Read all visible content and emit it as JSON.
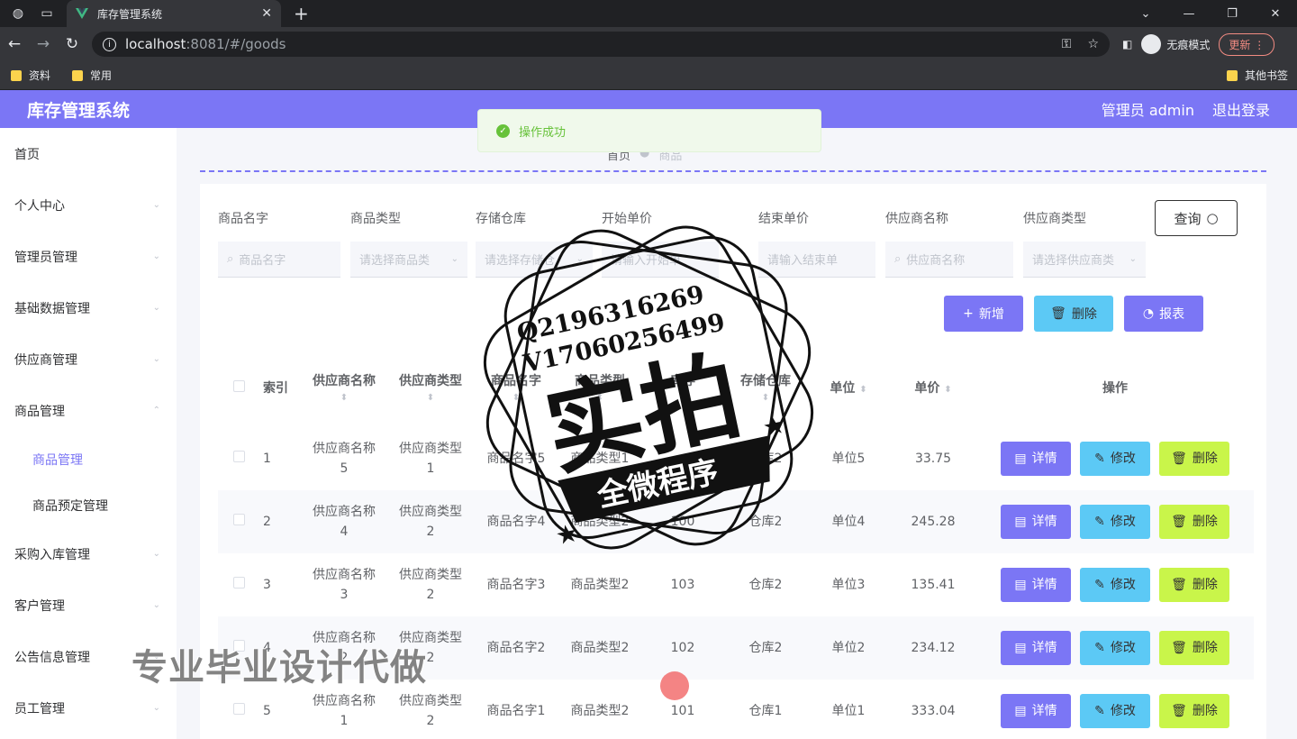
{
  "browser": {
    "tab_title": "库存管理系统",
    "url_host": "localhost",
    "url_path": ":8081/#/goods",
    "incognito_label": "无痕模式",
    "update_label": "更新",
    "bookmarks": [
      "资料",
      "常用"
    ],
    "other_bookmarks": "其他书签"
  },
  "header": {
    "title": "库存管理系统",
    "user_label": "管理员 admin",
    "logout_label": "退出登录"
  },
  "sidebar": {
    "items": [
      {
        "label": "首页"
      },
      {
        "label": "个人中心"
      },
      {
        "label": "管理员管理"
      },
      {
        "label": "基础数据管理"
      },
      {
        "label": "供应商管理"
      },
      {
        "label": "商品管理"
      }
    ],
    "sub_items": [
      {
        "label": "商品管理"
      },
      {
        "label": "商品预定管理"
      }
    ],
    "items_after": [
      {
        "label": "采购入库管理"
      },
      {
        "label": "客户管理"
      },
      {
        "label": "公告信息管理"
      },
      {
        "label": "员工管理"
      }
    ]
  },
  "breadcrumb": [
    "首页",
    "商品"
  ],
  "toast": "操作成功",
  "filters": {
    "labels": [
      "商品名字",
      "商品类型",
      "存储仓库",
      "开始单价",
      "结束单价",
      "供应商名称",
      "供应商类型"
    ],
    "placeholders": [
      "商品名字",
      "请选择商品类",
      "请选择存储仓",
      "请输入开始单",
      "请输入结束单",
      "供应商名称",
      "请选择供应商类"
    ],
    "query_label": "查询"
  },
  "actions": {
    "add": "新增",
    "delete": "删除",
    "report": "报表"
  },
  "table": {
    "headers": [
      "索引",
      "供应商名称",
      "供应商类型",
      "商品名字",
      "商品类型",
      "库存",
      "存储仓库",
      "单位",
      "单价",
      "操作"
    ],
    "rows": [
      {
        "idx": "1",
        "sn1": "供应商名称",
        "sn2": "5",
        "st1": "供应商类型",
        "st2": "1",
        "gn": "商品名字5",
        "gt": "商品类型1",
        "stock": "",
        "wh": "仓库2",
        "unit": "单位5",
        "price": "33.75"
      },
      {
        "idx": "2",
        "sn1": "供应商名称",
        "sn2": "4",
        "st1": "供应商类型",
        "st2": "2",
        "gn": "商品名字4",
        "gt": "商品类型2",
        "stock": "100",
        "wh": "仓库2",
        "unit": "单位4",
        "price": "245.28"
      },
      {
        "idx": "3",
        "sn1": "供应商名称",
        "sn2": "3",
        "st1": "供应商类型",
        "st2": "2",
        "gn": "商品名字3",
        "gt": "商品类型2",
        "stock": "103",
        "wh": "仓库2",
        "unit": "单位3",
        "price": "135.41"
      },
      {
        "idx": "4",
        "sn1": "供应商名称",
        "sn2": "2",
        "st1": "供应商类型",
        "st2": "2",
        "gn": "商品名字2",
        "gt": "商品类型2",
        "stock": "102",
        "wh": "仓库2",
        "unit": "单位2",
        "price": "234.12"
      },
      {
        "idx": "5",
        "sn1": "供应商名称",
        "sn2": "1",
        "st1": "供应商类型",
        "st2": "2",
        "gn": "商品名字1",
        "gt": "商品类型2",
        "stock": "101",
        "wh": "仓库1",
        "unit": "单位1",
        "price": "333.04"
      }
    ],
    "op_labels": {
      "detail": "详情",
      "edit": "修改",
      "delete": "删除"
    }
  },
  "watermark": {
    "line1": "Q2196316269",
    "line2": "V17060256499",
    "main": "实拍",
    "banner": "全微程序",
    "bottom": "专业毕业设计代做"
  },
  "colors": {
    "accent": "#7b76f5",
    "cyan": "#5cc9f5",
    "lime": "#c9f54a",
    "success": "#67c23a"
  }
}
